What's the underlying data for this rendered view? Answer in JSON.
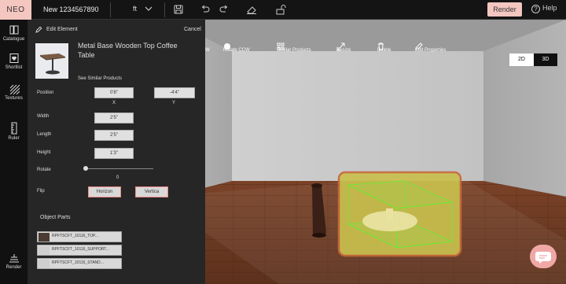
{
  "topbar": {
    "logo": "NEO",
    "project_name": "New 1234567890",
    "unit": "ft",
    "render_label": "Render",
    "help_label": "Help",
    "icons": [
      "chevron-down-icon",
      "save-icon",
      "undo-icon",
      "redo-icon",
      "eraser-icon",
      "unlock-icon"
    ]
  },
  "rail": {
    "items": [
      {
        "label": "Catalogue",
        "icon": "catalogue-icon"
      },
      {
        "label": "Shortlist",
        "icon": "heart-icon"
      },
      {
        "label": "Textures",
        "icon": "textures-icon"
      },
      {
        "label": "Ruler",
        "icon": "ruler-icon"
      },
      {
        "label": "Render",
        "icon": "render-icon"
      }
    ]
  },
  "actions": {
    "rotate_cw_fragment": "W",
    "rotate_ccw": "Rotate CCW",
    "similar_products": "Similar Products",
    "resize": "Resize",
    "delete": "Delete",
    "edit_properties": "Edit Properties"
  },
  "view_toggle": {
    "two_d": "2D",
    "three_d": "3D",
    "active": "3D"
  },
  "panel": {
    "title": "Edit Element",
    "cancel": "Cancel",
    "product_name": "Metal Base Wooden Top Coffee Table",
    "similar_link": "See Similar Products",
    "position": {
      "label": "Position",
      "x_value": "0'8\"",
      "y_value": "-4'4\"",
      "x_label": "X",
      "y_label": "Y"
    },
    "width": {
      "label": "Width",
      "value": "2'5\""
    },
    "length": {
      "label": "Length",
      "value": "2'5\""
    },
    "height": {
      "label": "Height",
      "value": "1'3\""
    },
    "rotate": {
      "label": "Rotate",
      "value": "0",
      "level": 0
    },
    "flip": {
      "label": "Flip",
      "horizontal": "Horizon",
      "vertical": "Vertica"
    },
    "object_parts": {
      "label": "Object Parts",
      "parts": [
        {
          "name": "RPFTSCFT_10116_TOP...",
          "swatch": "#4a3b33"
        },
        {
          "name": "RPFTSCFT_10116_SUPPORT...",
          "swatch": "#cfcfcf"
        },
        {
          "name": "RPFTSCFT_10116_STAND...",
          "swatch": "#cfcfcf"
        }
      ]
    }
  },
  "colors": {
    "accent": "#f4c6c0",
    "selection_fill": "#c9c04e",
    "selection_border": "#c86a3a",
    "bbox_green": "#66ee33",
    "floor": "#6a3a22"
  }
}
